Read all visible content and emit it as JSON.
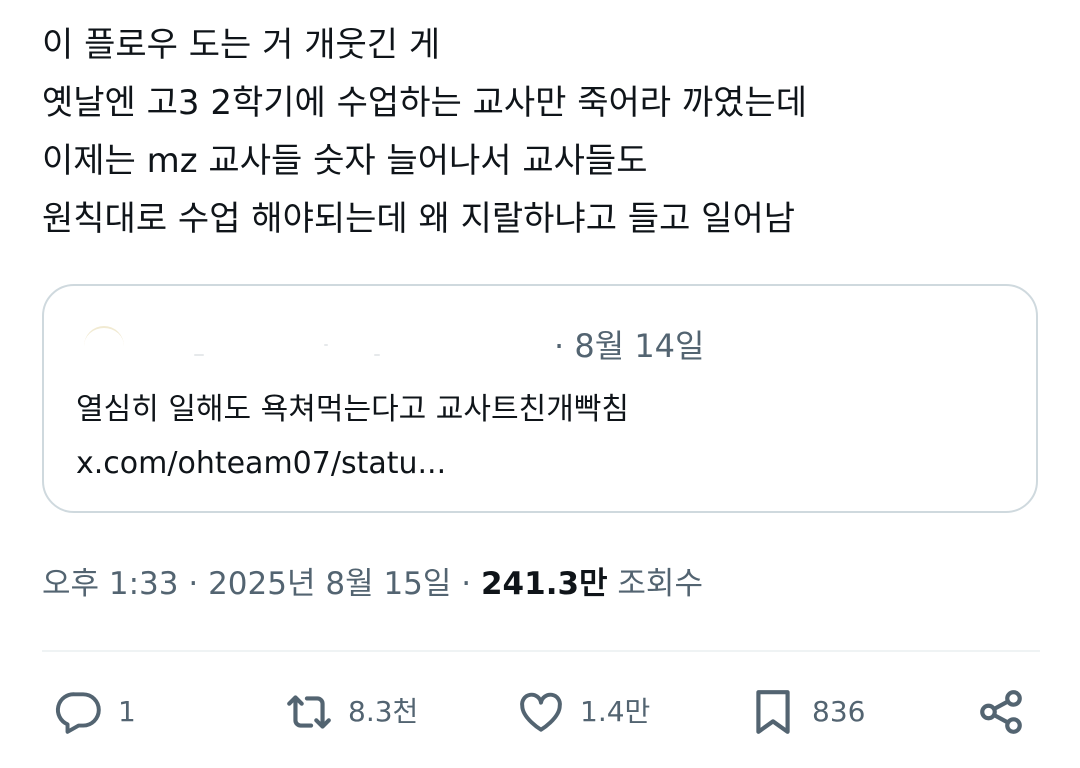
{
  "tweet": {
    "lines": [
      "이 플로우 도는 거 개웃긴 게",
      "옛날엔 고3 2학기에 수업하는 교사만 죽어라 까였는데",
      "이제는 mz 교사들 숫자 늘어나서 교사들도",
      "원칙대로 수업 해야되는데 왜 지랄하냐고 들고 일어남"
    ]
  },
  "quote": {
    "date": "· 8월 14일",
    "text": "열심히 일해도 욕쳐먹는다고 교사트친개빡침",
    "link": "x.com/ohteam07/statu..."
  },
  "meta": {
    "time": "오후 1:33",
    "sep1": " · ",
    "date": "2025년 8월 15일",
    "sep2": " · ",
    "views_count": "241.3만",
    "views_label": " 조회수"
  },
  "actions": {
    "reply_count": "1",
    "retweet_count": "8.3천",
    "like_count": "1.4만",
    "bookmark_count": "836"
  },
  "icons": {
    "reply": "speech-bubble-icon",
    "retweet": "retweet-arrows-icon",
    "like": "heart-icon",
    "bookmark": "bookmark-icon",
    "share": "share-nodes-icon"
  },
  "colors": {
    "text": "#0f1419",
    "secondary": "#536471",
    "border": "#cfd9de",
    "divider": "#eff3f4"
  }
}
